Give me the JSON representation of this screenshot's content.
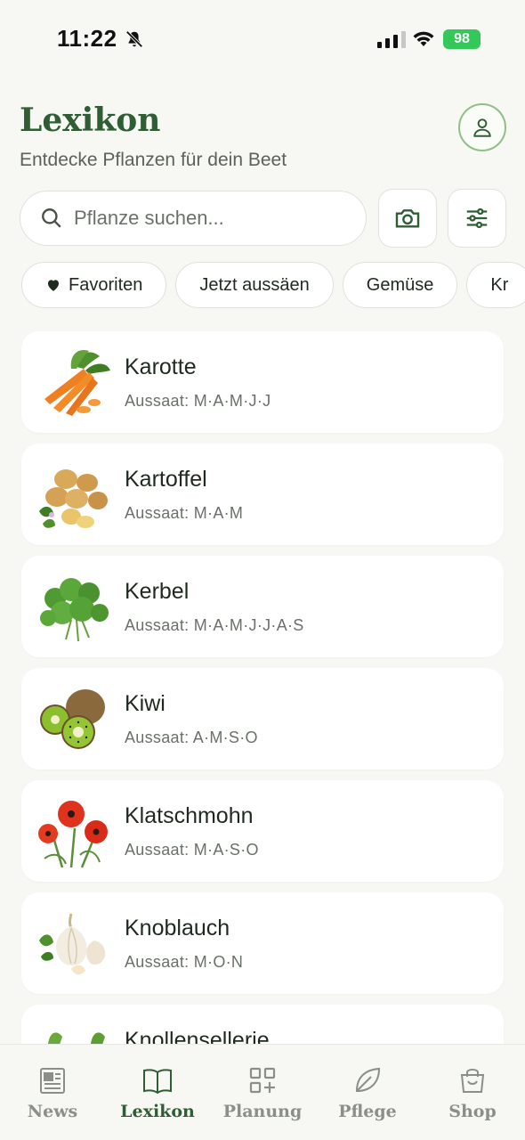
{
  "status": {
    "time": "11:22",
    "battery": "98"
  },
  "header": {
    "title": "Lexikon",
    "subtitle": "Entdecke Pflanzen für dein Beet"
  },
  "search": {
    "placeholder": "Pflanze suchen..."
  },
  "chips": [
    "Favoriten",
    "Jetzt aussäen",
    "Gemüse",
    "Kr"
  ],
  "plants": [
    {
      "name": "Karotte",
      "sowing": "Aussaat: M·A·M·J·J",
      "icon": "carrot-icon"
    },
    {
      "name": "Kartoffel",
      "sowing": "Aussaat: M·A·M",
      "icon": "potato-icon"
    },
    {
      "name": "Kerbel",
      "sowing": "Aussaat: M·A·M·J·J·A·S",
      "icon": "chervil-icon"
    },
    {
      "name": "Kiwi",
      "sowing": "Aussaat: A·M·S·O",
      "icon": "kiwi-icon"
    },
    {
      "name": "Klatschmohn",
      "sowing": "Aussaat: M·A·S·O",
      "icon": "poppy-icon"
    },
    {
      "name": "Knoblauch",
      "sowing": "Aussaat: M·O·N",
      "icon": "garlic-icon"
    },
    {
      "name": "Knollensellerie",
      "sowing": "",
      "icon": "celeriac-icon"
    }
  ],
  "nav": {
    "items": [
      "News",
      "Lexikon",
      "Planung",
      "Pflege",
      "Shop"
    ],
    "active": "Lexikon"
  },
  "colors": {
    "accent": "#2f5d34",
    "background": "#f7f8f3",
    "battery": "#34c759"
  }
}
